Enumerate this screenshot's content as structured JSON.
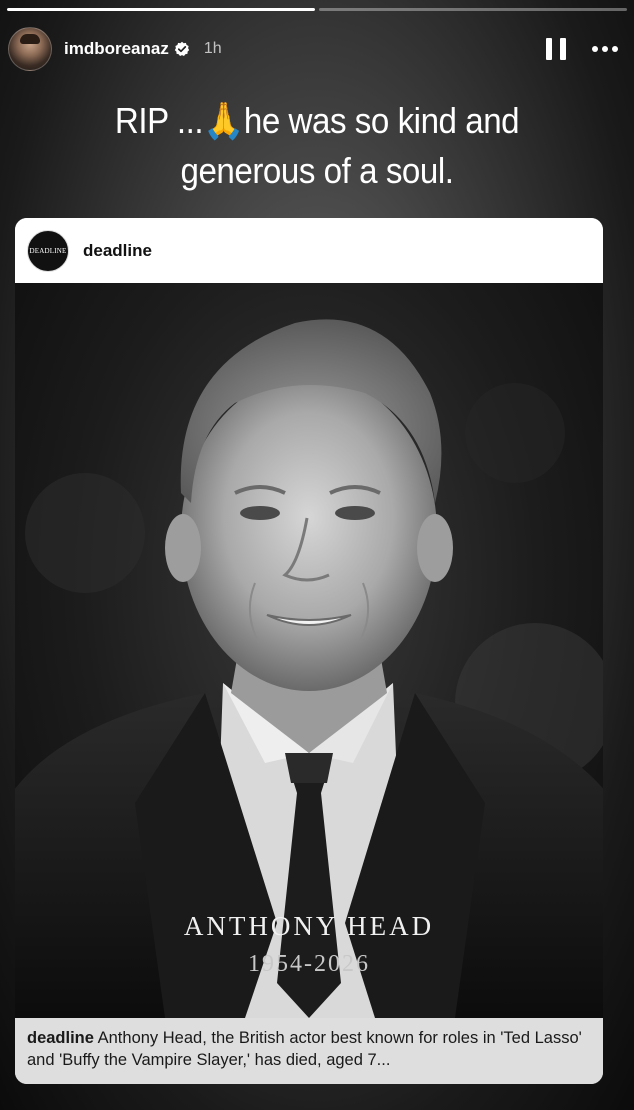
{
  "story": {
    "progress": [
      1.0,
      0.0
    ],
    "username": "imdboreanaz",
    "verified_icon": "verified-badge-icon",
    "time_ago": "1h",
    "pause_icon": "pause-icon",
    "more_icon": "more-options-icon",
    "caption_part1": "RIP ...",
    "caption_emoji": "🙏",
    "caption_part2": "he was so kind and generous of a soul."
  },
  "shared_post": {
    "account": "deadline",
    "avatar_text": "DEADLINE",
    "photo_name": "ANTHONY HEAD",
    "photo_years": "1954-2026",
    "caption_user": "deadline",
    "caption_text": "Anthony Head, the British actor best known for roles in 'Ted Lasso' and 'Buffy the Vampire Slayer,' has died, aged 7..."
  },
  "colors": {
    "text_primary": "#ffffff",
    "card_bg": "#ffffff",
    "footer_bg": "#dedede"
  }
}
